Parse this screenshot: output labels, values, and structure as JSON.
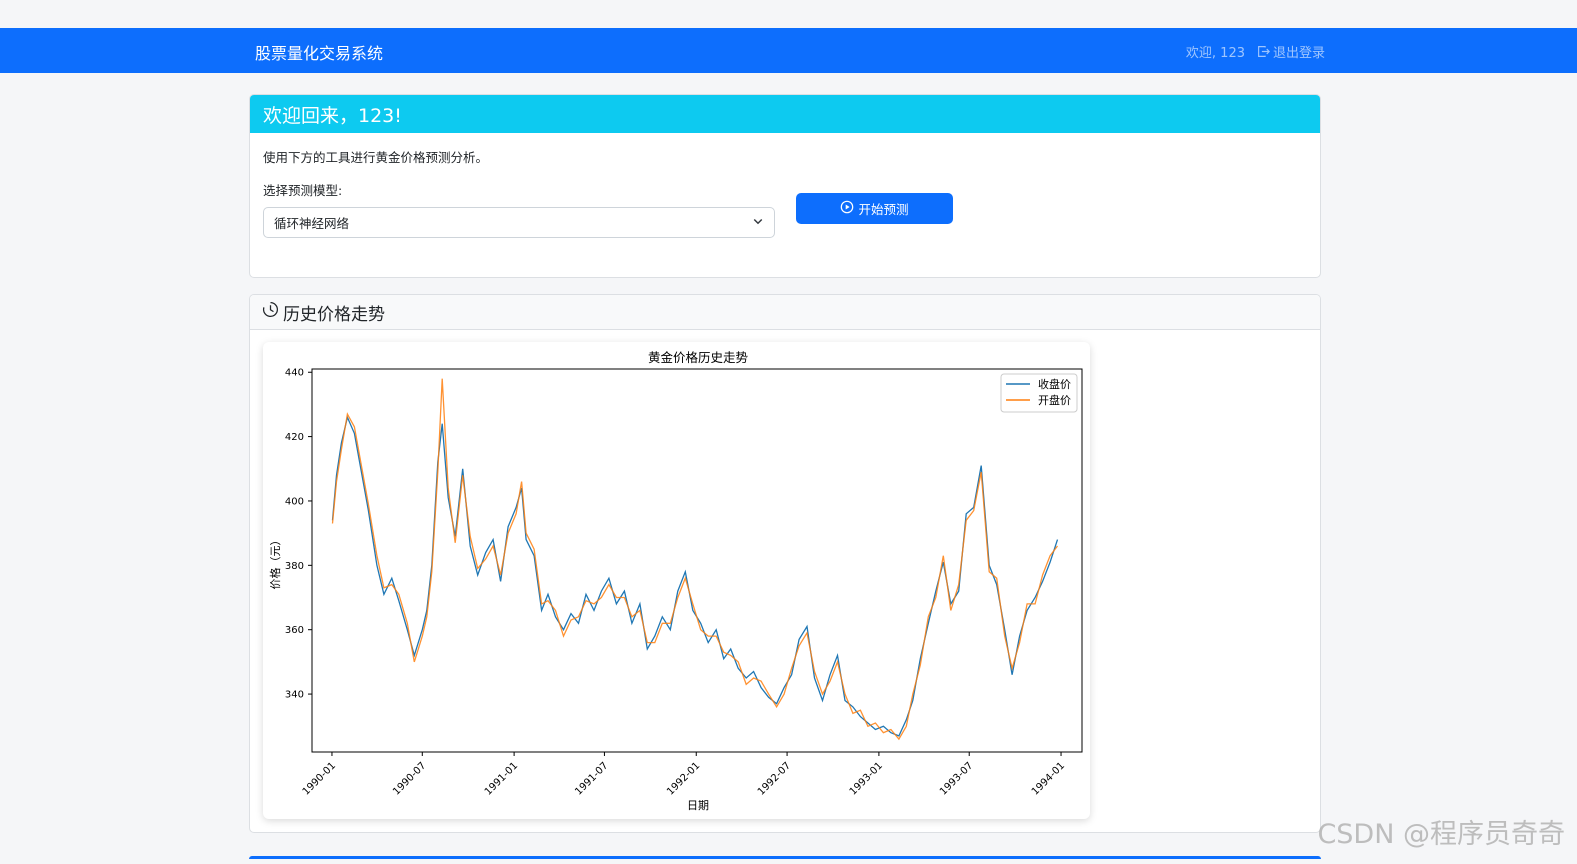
{
  "navbar": {
    "brand": "股票量化交易系统",
    "welcome": "欢迎, 123",
    "logout_label": "退出登录"
  },
  "welcome_card": {
    "title": "欢迎回来，123!",
    "intro": "使用下方的工具进行黄金价格预测分析。",
    "select_label": "选择预测模型:",
    "selected_model": "循环神经网络",
    "predict_button": "开始预测"
  },
  "history_card": {
    "title": "历史价格走势"
  },
  "watermark": "CSDN @程序员奇奇",
  "colors": {
    "primary": "#0d6efd",
    "info": "#0dcaf0",
    "close_series": "#1f77b4",
    "open_series": "#ff7f0e"
  },
  "chart_data": {
    "type": "line",
    "title": "黄金价格历史走势",
    "xlabel": "日期",
    "ylabel": "价格（元）",
    "x_ticks": [
      "1990-01",
      "1990-07",
      "1991-01",
      "1991-07",
      "1992-01",
      "1992-07",
      "1993-01",
      "1993-07",
      "1994-01"
    ],
    "y_ticks": [
      340,
      360,
      380,
      400,
      420,
      440
    ],
    "xlim": [
      "1989-11-22",
      "1994-02-12"
    ],
    "ylim": [
      322,
      441
    ],
    "legend_position": "top-right",
    "grid": false,
    "series": [
      {
        "name": "收盘价",
        "x": [
          "1990-01-02",
          "1990-01-10",
          "1990-01-20",
          "1990-02-01",
          "1990-02-15",
          "1990-03-01",
          "1990-03-15",
          "1990-04-01",
          "1990-04-15",
          "1990-05-01",
          "1990-05-15",
          "1990-06-01",
          "1990-06-15",
          "1990-07-01",
          "1990-07-10",
          "1990-07-20",
          "1990-08-01",
          "1990-08-10",
          "1990-08-22",
          "1990-09-05",
          "1990-09-20",
          "1990-10-05",
          "1990-10-20",
          "1990-11-05",
          "1990-11-20",
          "1990-12-05",
          "1990-12-20",
          "1991-01-05",
          "1991-01-16",
          "1991-01-25",
          "1991-02-10",
          "1991-02-25",
          "1991-03-10",
          "1991-03-25",
          "1991-04-10",
          "1991-04-25",
          "1991-05-10",
          "1991-05-25",
          "1991-06-10",
          "1991-06-25",
          "1991-07-10",
          "1991-07-25",
          "1991-08-10",
          "1991-08-25",
          "1991-09-10",
          "1991-09-25",
          "1991-10-10",
          "1991-10-25",
          "1991-11-10",
          "1991-11-25",
          "1991-12-10",
          "1991-12-25",
          "1992-01-10",
          "1992-01-25",
          "1992-02-10",
          "1992-02-25",
          "1992-03-10",
          "1992-03-25",
          "1992-04-10",
          "1992-04-25",
          "1992-05-10",
          "1992-05-25",
          "1992-06-10",
          "1992-06-25",
          "1992-07-10",
          "1992-07-25",
          "1992-08-10",
          "1992-08-25",
          "1992-09-10",
          "1992-09-25",
          "1992-10-10",
          "1992-10-25",
          "1992-11-10",
          "1992-11-25",
          "1992-12-10",
          "1992-12-25",
          "1993-01-10",
          "1993-01-25",
          "1993-02-10",
          "1993-02-25",
          "1993-03-10",
          "1993-03-25",
          "1993-04-10",
          "1993-04-25",
          "1993-05-10",
          "1993-05-25",
          "1993-06-10",
          "1993-06-25",
          "1993-07-10",
          "1993-07-25",
          "1993-08-10",
          "1993-08-25",
          "1993-09-10",
          "1993-09-25",
          "1993-10-10",
          "1993-10-25",
          "1993-11-10",
          "1993-11-25",
          "1993-12-10",
          "1993-12-25"
        ],
        "values": [
          394,
          408,
          418,
          426,
          421,
          409,
          397,
          380,
          371,
          376,
          369,
          360,
          352,
          360,
          366,
          380,
          412,
          424,
          401,
          389,
          410,
          386,
          377,
          384,
          388,
          375,
          392,
          398,
          404,
          388,
          383,
          366,
          371,
          364,
          360,
          365,
          362,
          371,
          366,
          372,
          376,
          368,
          372,
          362,
          368,
          354,
          358,
          364,
          360,
          372,
          378,
          366,
          362,
          356,
          360,
          351,
          354,
          348,
          345,
          347,
          342,
          339,
          337,
          342,
          346,
          357,
          361,
          345,
          338,
          346,
          352,
          338,
          336,
          333,
          331,
          329,
          330,
          328,
          327,
          332,
          338,
          351,
          362,
          372,
          381,
          368,
          372,
          396,
          398,
          411,
          380,
          374,
          360,
          346,
          358,
          366,
          370,
          375,
          381,
          388
        ]
      },
      {
        "name": "开盘价",
        "x": [
          "1990-01-02",
          "1990-01-10",
          "1990-01-20",
          "1990-02-01",
          "1990-02-15",
          "1990-03-01",
          "1990-03-15",
          "1990-04-01",
          "1990-04-15",
          "1990-05-01",
          "1990-05-15",
          "1990-06-01",
          "1990-06-15",
          "1990-07-01",
          "1990-07-10",
          "1990-07-20",
          "1990-08-01",
          "1990-08-10",
          "1990-08-22",
          "1990-09-05",
          "1990-09-20",
          "1990-10-05",
          "1990-10-20",
          "1990-11-05",
          "1990-11-20",
          "1990-12-05",
          "1990-12-20",
          "1991-01-05",
          "1991-01-16",
          "1991-01-25",
          "1991-02-10",
          "1991-02-25",
          "1991-03-10",
          "1991-03-25",
          "1991-04-10",
          "1991-04-25",
          "1991-05-10",
          "1991-05-25",
          "1991-06-10",
          "1991-06-25",
          "1991-07-10",
          "1991-07-25",
          "1991-08-10",
          "1991-08-25",
          "1991-09-10",
          "1991-09-25",
          "1991-10-10",
          "1991-10-25",
          "1991-11-10",
          "1991-11-25",
          "1991-12-10",
          "1991-12-25",
          "1992-01-10",
          "1992-01-25",
          "1992-02-10",
          "1992-02-25",
          "1992-03-10",
          "1992-03-25",
          "1992-04-10",
          "1992-04-25",
          "1992-05-10",
          "1992-05-25",
          "1992-06-10",
          "1992-06-25",
          "1992-07-10",
          "1992-07-25",
          "1992-08-10",
          "1992-08-25",
          "1992-09-10",
          "1992-09-25",
          "1992-10-10",
          "1992-10-25",
          "1992-11-10",
          "1992-11-25",
          "1992-12-10",
          "1992-12-25",
          "1993-01-10",
          "1993-01-25",
          "1993-02-10",
          "1993-02-25",
          "1993-03-10",
          "1993-03-25",
          "1993-04-10",
          "1993-04-25",
          "1993-05-10",
          "1993-05-25",
          "1993-06-10",
          "1993-06-25",
          "1993-07-10",
          "1993-07-25",
          "1993-08-10",
          "1993-08-25",
          "1993-09-10",
          "1993-09-25",
          "1993-10-10",
          "1993-10-25",
          "1993-11-10",
          "1993-11-25",
          "1993-12-10",
          "1993-12-25"
        ],
        "values": [
          393,
          406,
          416,
          427,
          423,
          411,
          399,
          383,
          373,
          374,
          371,
          362,
          350,
          358,
          364,
          378,
          409,
          438,
          404,
          387,
          408,
          389,
          379,
          382,
          386,
          377,
          390,
          396,
          406,
          390,
          385,
          368,
          369,
          366,
          358,
          363,
          364,
          369,
          368,
          370,
          374,
          370,
          370,
          364,
          366,
          356,
          356,
          362,
          362,
          370,
          376,
          368,
          360,
          358,
          358,
          353,
          352,
          350,
          343,
          345,
          344,
          340,
          336,
          340,
          348,
          355,
          359,
          347,
          340,
          344,
          350,
          340,
          334,
          335,
          330,
          331,
          328,
          329,
          326,
          330,
          340,
          349,
          364,
          370,
          383,
          366,
          374,
          394,
          397,
          409,
          378,
          376,
          358,
          348,
          356,
          368,
          368,
          377,
          383,
          386
        ]
      }
    ]
  }
}
